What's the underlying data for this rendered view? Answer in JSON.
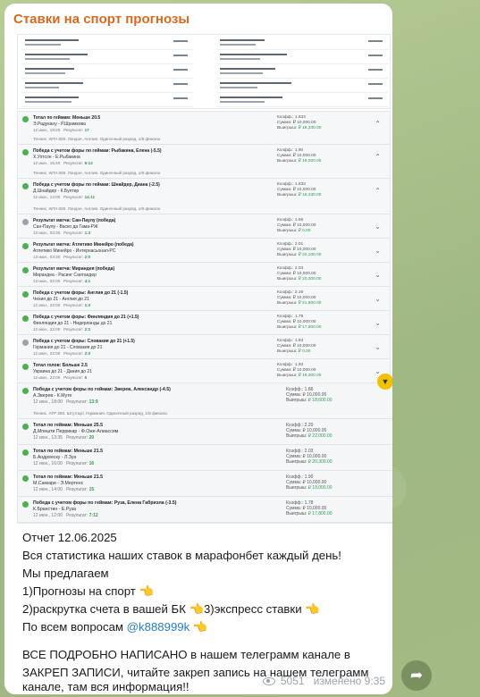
{
  "channel": {
    "title": "Ставки на спорт прогнозы"
  },
  "bets_top": [
    {
      "title": "Тотал по геймам: Меньше 20.5",
      "match": "Э.Радукану - Р.Шрамкова",
      "date": "12 июн., 18:20",
      "result_label": "Результат:",
      "result": "17",
      "coef_label": "Коэфф.:",
      "coef": "1.833",
      "sum_label": "Сумма:",
      "sum": "₽ 10,000.00",
      "win_label": "Выигрыш:",
      "win": "₽ 18,330.00",
      "tour": "Теннис. WTA 500. Лондон, Англия. Одиночный разряд, 1/8 финала",
      "status": "win"
    },
    {
      "title": "Победа с учетом форы по геймам: Рыбакина, Елена (-5.5)",
      "match": "Х.Уотсон - Е.Рыбакина",
      "date": "12 июн., 16:40",
      "result_label": "Результат:",
      "result": "6:12",
      "coef_label": "Коэфф.:",
      "coef": "1.90",
      "sum_label": "Сумма:",
      "sum": "₽ 10,000.00",
      "win_label": "Выигрыш:",
      "win": "₽ 19,000.00",
      "tour": "Теннис. WTA 500. Лондон, Англия. Одиночный разряд, 1/8 финала",
      "status": "win"
    },
    {
      "title": "Победа с учетом форы по геймам: Шнайдер, Диана (-2.5)",
      "match": "Д.Шнайдер - К.Бултер",
      "date": "12 июн., 14:00",
      "result_label": "Результат:",
      "result": "14:11",
      "coef_label": "Коэфф.:",
      "coef": "1.833",
      "sum_label": "Сумма:",
      "sum": "₽ 10,000.00",
      "win_label": "Выигрыш:",
      "win": "₽ 18,330.00",
      "tour": "Теннис. WTA 500. Лондон, Англия. Одиночный разряд, 1/8 финала",
      "status": "win"
    },
    {
      "title": "Результат матча: Сан-Паулу (победа)",
      "match": "Сан-Паулу - Васко да Гама-РЖ",
      "date": "13 июн., 03:30",
      "result_label": "Результат:",
      "result": "1:3",
      "coef_label": "Коэфф.:",
      "coef": "1.66",
      "sum_label": "Сумма:",
      "sum": "₽ 10,000.00",
      "win_label": "Выигрыш:",
      "win": "₽ 0.00",
      "status": "lose"
    },
    {
      "title": "Результат матча: Атлетико Минейро (победа)",
      "match": "Атлетико Минейро - Интернасьонал-РС",
      "date": "13 июн., 03:30",
      "result_label": "Результат:",
      "result": "2:0",
      "coef_label": "Коэфф.:",
      "coef": "2.01",
      "sum_label": "Сумма:",
      "sum": "₽ 10,000.00",
      "win_label": "Выигрыш:",
      "win": "₽ 20,100.00",
      "status": "win"
    },
    {
      "title": "Результат матча: Мирандея (победа)",
      "match": "Мирандеа - Расинг Сантандер",
      "date": "13 июн., 02:00",
      "result_label": "Результат:",
      "result": "4:1",
      "coef_label": "Коэфф.:",
      "coef": "2.03",
      "sum_label": "Сумма:",
      "sum": "₽ 10,000.00",
      "win_label": "Выигрыш:",
      "win": "₽ 20,300.00",
      "status": "win"
    },
    {
      "title": "Победа с учетом форы: Англия до 21 (-1.5)",
      "match": "Чехия до 21 - Англия до 21",
      "date": "12 июн., 22:00",
      "result_label": "Результат:",
      "result": "1:3",
      "coef_label": "Коэфф.:",
      "coef": "2.19",
      "sum_label": "Сумма:",
      "sum": "₽ 10,000.00",
      "win_label": "Выигрыш:",
      "win": "₽ 21,900.00",
      "status": "win"
    },
    {
      "title": "Победа с учетом форы: Финляндия до 21 (+1.5)",
      "match": "Финляндия до 21 - Нидерланды до 21",
      "date": "12 июн., 22:00",
      "result_label": "Результат:",
      "result": "2:2",
      "coef_label": "Коэфф.:",
      "coef": "1.79",
      "sum_label": "Сумма:",
      "sum": "₽ 10,000.00",
      "win_label": "Выигрыш:",
      "win": "₽ 17,900.00",
      "status": "win"
    },
    {
      "title": "Победа с учетом форы: Словакия до 21 (+1.5)",
      "match": "Германия до 21 - Словакия до 21",
      "date": "12 июн., 22:00",
      "result_label": "Результат:",
      "result": "2:0",
      "coef_label": "Коэфф.:",
      "coef": "1.83",
      "sum_label": "Сумма:",
      "sum": "₽ 10,000.00",
      "win_label": "Выигрыш:",
      "win": "₽ 0.00",
      "status": "lose"
    },
    {
      "title": "Тотал голов: Больше 2.5",
      "match": "Украина до 21 - Дания до 21",
      "date": "12 июн., 22:00",
      "result_label": "Результат:",
      "result": "5",
      "coef_label": "Коэфф.:",
      "coef": "1.93",
      "sum_label": "Сумма:",
      "sum": "₽ 10,000.00",
      "win_label": "Выигрыш:",
      "win": "₽ 19,300.00",
      "status": "win"
    }
  ],
  "bets_bottom": [
    {
      "title": "Победа с учетом форы по геймам: Зверев, Александр (-4.5)",
      "match": "А.Зверев - К.Муте",
      "date": "12 июн., 18:00",
      "result_label": "Результат:",
      "result": "13:9",
      "coef_label": "Коэфф.:",
      "coef": "1.86",
      "sum_label": "Сумма:",
      "sum": "₽ 10,000.00",
      "win_label": "Выигрыш:",
      "win": "₽ 18,600.00",
      "tour": "Теннис. ATP 250. Штутгарт, Германия. Одиночный разряд, 1/8 финала"
    },
    {
      "title": "Тотал по геймам: Меньше 25.5",
      "match": "Д.Мпешти Перрикар - Ф.Оже-Алиассим",
      "date": "12 июн., 13:35",
      "result_label": "Результат:",
      "result": "20",
      "coef_label": "Коэфф.:",
      "coef": "2.20",
      "sum_label": "Сумма:",
      "sum": "₽ 10,000.00",
      "win_label": "Выигрыш:",
      "win": "₽ 22,000.00"
    },
    {
      "title": "Тотал по геймам: Меньше 21.5",
      "match": "Б.Андреескy - Л.Зун",
      "date": "12 июн., 16:00",
      "result_label": "Результат:",
      "result": "16",
      "coef_label": "Коэфф.:",
      "coef": "2.03",
      "sum_label": "Сумма:",
      "sum": "₽ 10,000.00",
      "win_label": "Выигрыш:",
      "win": "₽ 20,300.00"
    },
    {
      "title": "Тотал по геймам: Меньше 21.5",
      "match": "М.Саккари - Э.Мертенс",
      "date": "12 июн., 14:00",
      "result_label": "Результат:",
      "result": "15",
      "coef_label": "Коэфф.:",
      "coef": "1.90",
      "sum_label": "Сумма:",
      "sum": "₽ 10,000.00",
      "win_label": "Выигрыш:",
      "win": "₽ 19,000.00"
    },
    {
      "title": "Победа с учетом форы по геймам: Руза, Елена Габриэла (-3.5)",
      "match": "К.Бранстин - Е.Руза",
      "date": "12 июн., 12:00",
      "result_label": "Результат:",
      "result": "7:12",
      "coef_label": "Коэфф.:",
      "coef": "1.78",
      "sum_label": "Сумма:",
      "sum": "₽ 10,000.00",
      "win_label": "Выигрыш:",
      "win": "₽ 17,800.00"
    }
  ],
  "message": {
    "line1": "Отчет   12.06.2025",
    "line2": "Вся статистика наших ставок в марафонбет каждый день!",
    "line3": "Мы предлагаем",
    "line4": "1)Прогнозы на спорт 👈",
    "line5a": "2)раскрутка счета в вашей БК 👈",
    "line5b": "3)экспресс ставки 👈",
    "line6a": "По всем вопросам ",
    "line6_link": "@k888999k",
    "line6b": " 👈",
    "line7": "ВСЕ ПОДРОБНО НАПИСАНО в нашем телеграмм канале в",
    "line8": "ЗАКРЕП ЗАПИСИ, читайте закреп запись на нашем телеграмм",
    "line9": "канале, там вся информация!!"
  },
  "meta": {
    "views": "5051",
    "edited": "изменено 9:35"
  },
  "colors": {
    "title": "#d46a21",
    "link": "#2a7cc0",
    "win": "#2e9a4a",
    "bg": "#a9bf8c"
  }
}
